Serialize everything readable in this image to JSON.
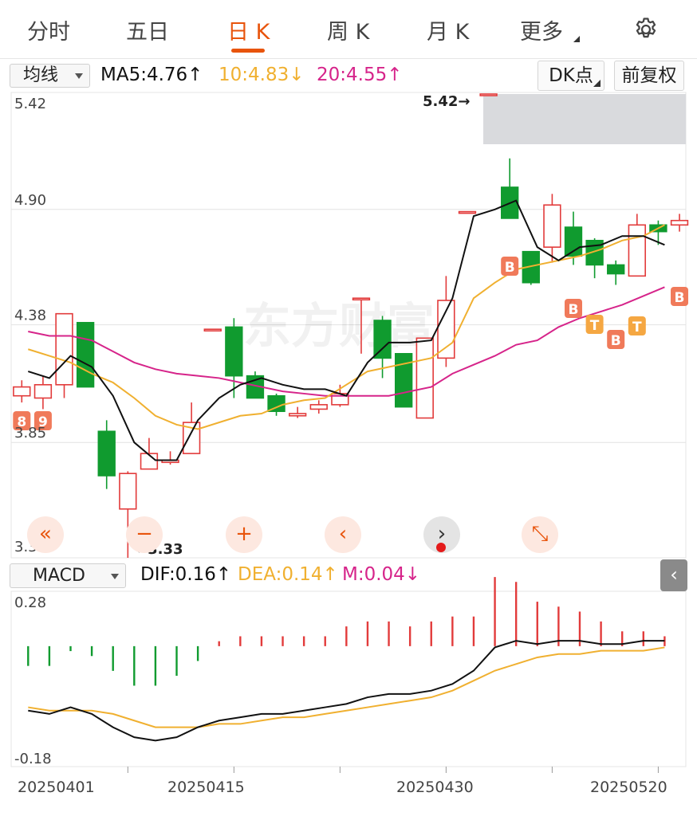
{
  "tabs": [
    {
      "label": "分时",
      "active": false
    },
    {
      "label": "五日",
      "active": false
    },
    {
      "label": "日 K",
      "active": true
    },
    {
      "label": "周 K",
      "active": false
    },
    {
      "label": "月 K",
      "active": false
    },
    {
      "label": "更多",
      "active": false
    }
  ],
  "settings_icon": "gear-icon",
  "main_indicator": {
    "select_label": "均线",
    "ma5": "MA5:4.76↑",
    "ma10": "10:4.83↓",
    "ma20": "20:4.55↑",
    "dk_label": "DK点",
    "adjust_label": "前复权"
  },
  "price_axis": [
    "5.42",
    "4.90",
    "4.38",
    "3.85",
    "3.33"
  ],
  "peak_label": "5.42→",
  "low_label": "←3.33",
  "watermark": "东方财富",
  "nav_buttons": [
    {
      "name": "rewind-button",
      "glyph": "«"
    },
    {
      "name": "zoom-out-button",
      "glyph": "−"
    },
    {
      "name": "zoom-in-button",
      "glyph": "+"
    },
    {
      "name": "prev-button",
      "glyph": "‹"
    },
    {
      "name": "next-button",
      "glyph": "›"
    },
    {
      "name": "fullscreen-button",
      "glyph": "⤡"
    }
  ],
  "sub_indicator": {
    "select_label": "MACD",
    "dif": "DIF:0.16↑",
    "dea": "DEA:0.14↑",
    "m": "M:0.04↓",
    "axis": [
      "0.28",
      "-0.18"
    ]
  },
  "dates": [
    "20250401",
    "20250415",
    "20250430",
    "20250520"
  ],
  "markers": [
    "8",
    "9",
    "B",
    "B",
    "T",
    "B",
    "T",
    "B"
  ],
  "colors": {
    "up": "#e23b3b",
    "down": "#109b2f",
    "ma5": "#111111",
    "ma10": "#f0b030",
    "ma20": "#d6248a",
    "accent": "#e8540c"
  },
  "chart_data": {
    "type": "candlestick",
    "ylim": [
      3.33,
      5.42
    ],
    "candles": [
      {
        "o": 4.06,
        "c": 4.1,
        "h": 4.13,
        "l": 4.03
      },
      {
        "o": 4.05,
        "c": 4.11,
        "h": 4.15,
        "l": 4.0
      },
      {
        "o": 4.11,
        "c": 4.43,
        "h": 4.43,
        "l": 4.05
      },
      {
        "o": 4.39,
        "c": 4.1,
        "h": 4.39,
        "l": 4.1
      },
      {
        "o": 3.9,
        "c": 3.7,
        "h": 3.95,
        "l": 3.64
      },
      {
        "o": 3.55,
        "c": 3.71,
        "h": 3.72,
        "l": 3.33
      },
      {
        "o": 3.73,
        "c": 3.8,
        "h": 3.87,
        "l": 3.73
      },
      {
        "o": 3.76,
        "c": 3.77,
        "h": 3.81,
        "l": 3.75
      },
      {
        "o": 3.8,
        "c": 3.94,
        "h": 4.03,
        "l": 3.8
      },
      {
        "o": 4.36,
        "c": 4.36,
        "h": 4.36,
        "l": 4.36
      },
      {
        "o": 4.37,
        "c": 4.15,
        "h": 4.41,
        "l": 4.05
      },
      {
        "o": 4.15,
        "c": 4.05,
        "h": 4.17,
        "l": 4.05
      },
      {
        "o": 4.06,
        "c": 3.99,
        "h": 4.07,
        "l": 3.97
      },
      {
        "o": 3.97,
        "c": 3.98,
        "h": 4.01,
        "l": 3.96
      },
      {
        "o": 4.0,
        "c": 4.02,
        "h": 4.04,
        "l": 3.98
      },
      {
        "o": 4.02,
        "c": 4.07,
        "h": 4.11,
        "l": 4.01
      },
      {
        "o": 4.5,
        "c": 4.5,
        "h": 4.5,
        "l": 4.25
      },
      {
        "o": 4.4,
        "c": 4.23,
        "h": 4.42,
        "l": 4.14
      },
      {
        "o": 4.25,
        "c": 4.01,
        "h": 4.25,
        "l": 4.01
      },
      {
        "o": 3.96,
        "c": 4.32,
        "h": 4.32,
        "l": 3.96
      },
      {
        "o": 4.23,
        "c": 4.49,
        "h": 4.6,
        "l": 4.19
      },
      {
        "o": 4.89,
        "c": 4.89,
        "h": 4.89,
        "l": 4.89
      },
      {
        "o": 5.42,
        "c": 5.42,
        "h": 5.42,
        "l": 5.42
      },
      {
        "o": 5.0,
        "c": 4.86,
        "h": 5.13,
        "l": 4.86
      },
      {
        "o": 4.71,
        "c": 4.57,
        "h": 4.71,
        "l": 4.56
      },
      {
        "o": 4.73,
        "c": 4.92,
        "h": 4.97,
        "l": 4.66
      },
      {
        "o": 4.82,
        "c": 4.69,
        "h": 4.89,
        "l": 4.65
      },
      {
        "o": 4.76,
        "c": 4.65,
        "h": 4.77,
        "l": 4.59
      },
      {
        "o": 4.65,
        "c": 4.61,
        "h": 4.67,
        "l": 4.56
      },
      {
        "o": 4.6,
        "c": 4.83,
        "h": 4.88,
        "l": 4.6
      },
      {
        "o": 4.83,
        "c": 4.8,
        "h": 4.85,
        "l": 4.74
      },
      {
        "o": 4.83,
        "c": 4.85,
        "h": 4.88,
        "l": 4.8
      }
    ],
    "ma5": [
      4.17,
      4.14,
      4.24,
      4.19,
      4.06,
      3.85,
      3.77,
      3.77,
      3.95,
      4.05,
      4.11,
      4.14,
      4.11,
      4.09,
      4.09,
      4.06,
      4.21,
      4.3,
      4.3,
      4.31,
      4.5,
      4.87,
      4.9,
      4.94,
      4.73,
      4.67,
      4.73,
      4.74,
      4.78,
      4.78,
      4.74
    ],
    "ma10": [
      4.27,
      4.24,
      4.21,
      4.16,
      4.12,
      4.05,
      3.97,
      3.93,
      3.91,
      3.94,
      3.97,
      3.98,
      4.02,
      4.04,
      4.05,
      4.11,
      4.17,
      4.19,
      4.21,
      4.23,
      4.3,
      4.5,
      4.57,
      4.63,
      4.65,
      4.67,
      4.69,
      4.72,
      4.76,
      4.78,
      4.83
    ],
    "ma20": [
      4.35,
      4.33,
      4.33,
      4.31,
      4.26,
      4.21,
      4.18,
      4.16,
      4.15,
      4.14,
      4.12,
      4.1,
      4.08,
      4.07,
      4.06,
      4.06,
      4.06,
      4.06,
      4.08,
      4.1,
      4.16,
      4.2,
      4.24,
      4.29,
      4.31,
      4.37,
      4.41,
      4.44,
      4.47,
      4.51,
      4.55
    ],
    "macd": {
      "ylim": [
        -0.18,
        0.28
      ],
      "dif": [
        -0.05,
        -0.06,
        -0.04,
        -0.06,
        -0.1,
        -0.13,
        -0.14,
        -0.13,
        -0.1,
        -0.08,
        -0.07,
        -0.06,
        -0.06,
        -0.05,
        -0.04,
        -0.03,
        -0.01,
        0.0,
        0.0,
        0.01,
        0.03,
        0.07,
        0.14,
        0.16,
        0.15,
        0.16,
        0.16,
        0.15,
        0.15,
        0.16,
        0.16
      ],
      "dea": [
        -0.04,
        -0.05,
        -0.05,
        -0.05,
        -0.06,
        -0.08,
        -0.1,
        -0.1,
        -0.1,
        -0.09,
        -0.09,
        -0.08,
        -0.07,
        -0.07,
        -0.06,
        -0.05,
        -0.04,
        -0.03,
        -0.02,
        -0.01,
        0.01,
        0.04,
        0.07,
        0.09,
        0.11,
        0.12,
        0.12,
        0.13,
        0.13,
        0.13,
        0.14
      ],
      "hist": [
        -0.04,
        -0.04,
        -0.01,
        -0.02,
        -0.05,
        -0.08,
        -0.08,
        -0.06,
        -0.03,
        0.01,
        0.02,
        0.02,
        0.02,
        0.02,
        0.02,
        0.04,
        0.05,
        0.05,
        0.04,
        0.05,
        0.06,
        0.06,
        0.14,
        0.13,
        0.09,
        0.08,
        0.07,
        0.05,
        0.03,
        0.03,
        0.02
      ]
    }
  }
}
